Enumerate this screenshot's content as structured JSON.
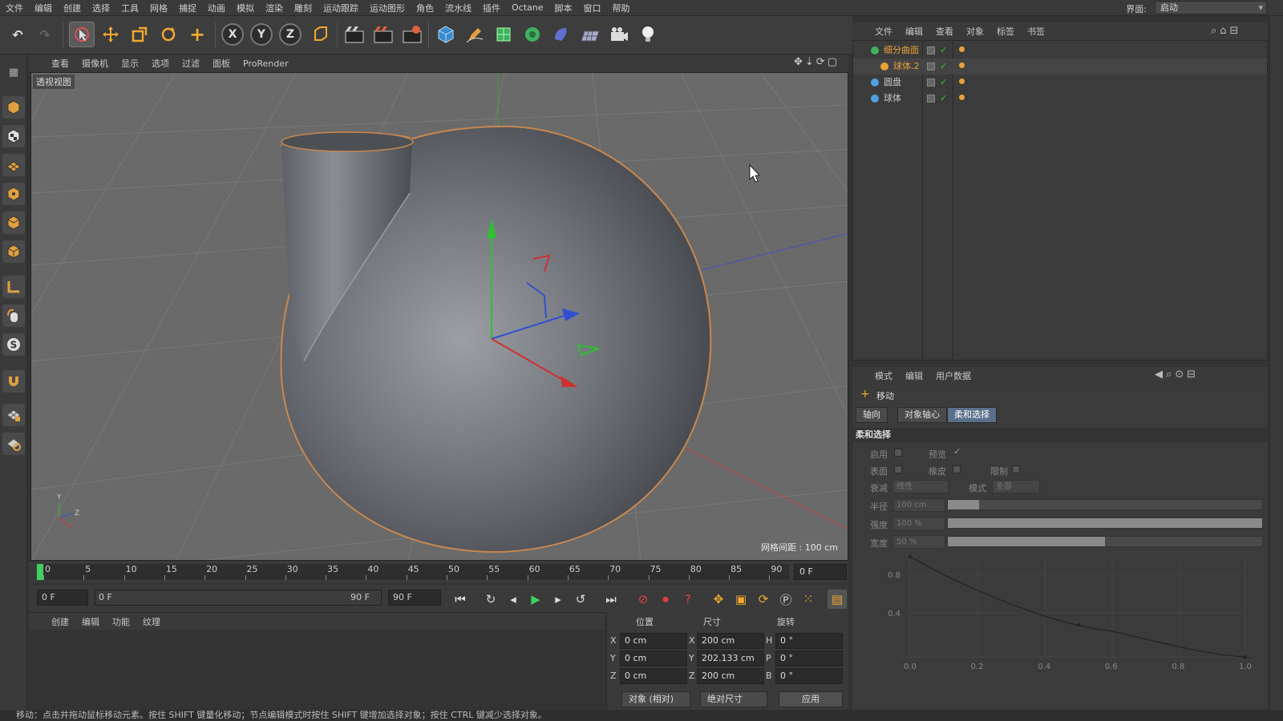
{
  "menubar": {
    "items": [
      "文件",
      "编辑",
      "创建",
      "选择",
      "工具",
      "网格",
      "捕捉",
      "动画",
      "模拟",
      "渲染",
      "雕刻",
      "运动跟踪",
      "运动图形",
      "角色",
      "流水线",
      "插件",
      "Octane",
      "脚本",
      "窗口",
      "帮助"
    ],
    "layout_label": "界面:",
    "layout_value": "启动"
  },
  "viewport": {
    "menu": [
      "查看",
      "摄像机",
      "显示",
      "选项",
      "过滤",
      "面板",
      "ProRender"
    ],
    "label": "透视视图",
    "grid_info": "网格间距 : 100 cm"
  },
  "timeline": {
    "ticks": [
      "0",
      "5",
      "10",
      "15",
      "20",
      "25",
      "30",
      "35",
      "40",
      "45",
      "50",
      "55",
      "60",
      "65",
      "70",
      "75",
      "80",
      "85",
      "90"
    ],
    "current_frame": "0 F",
    "start_field": "0 F",
    "range_start": "0 F",
    "range_end": "90 F",
    "end_field": "90 F"
  },
  "material_manager": {
    "menu": [
      "创建",
      "编辑",
      "功能",
      "纹理"
    ]
  },
  "coordinates": {
    "headers": {
      "position": "位置",
      "size": "尺寸",
      "rotation": "旋转"
    },
    "rows": [
      {
        "axis": "X",
        "pos": "0 cm",
        "size_axis": "X",
        "size": "200 cm",
        "rot_axis": "H",
        "rot": "0 °"
      },
      {
        "axis": "Y",
        "pos": "0 cm",
        "size_axis": "Y",
        "size": "202.133 cm",
        "rot_axis": "P",
        "rot": "0 °"
      },
      {
        "axis": "Z",
        "pos": "0 cm",
        "size_axis": "Z",
        "size": "200 cm",
        "rot_axis": "B",
        "rot": "0 °"
      }
    ],
    "mode_dropdown": "对象 (相对)",
    "size_dropdown": "绝对尺寸",
    "apply": "应用"
  },
  "object_manager": {
    "menu": [
      "文件",
      "编辑",
      "查看",
      "对象",
      "标签",
      "书签"
    ],
    "objects": [
      {
        "name": "细分曲面",
        "color": "#e8a23a"
      },
      {
        "name": "球体.2",
        "color": "#e8a23a"
      },
      {
        "name": "圆盘",
        "color": "#c8c8c8"
      },
      {
        "name": "球体",
        "color": "#c8c8c8"
      }
    ]
  },
  "attributes": {
    "menu": [
      "模式",
      "编辑",
      "用户数据"
    ],
    "tool_name": "移动",
    "tabs": [
      "轴向",
      "对象轴心",
      "柔和选择"
    ],
    "active_tab": "柔和选择",
    "section": "柔和选择",
    "labels": {
      "enable": "启用",
      "preview": "预览",
      "surface": "表面",
      "rubber": "橡皮",
      "restrict": "限制",
      "falloff": "衰减",
      "mode": "模式",
      "radius": "半径",
      "strength": "强度",
      "width": "宽度"
    },
    "values": {
      "falloff": "线性",
      "mode": "全部",
      "radius": "100 cm",
      "strength": "100 %",
      "width": "50 %"
    },
    "slider_levels": {
      "radius": 0.1,
      "strength": 1.0,
      "width": 0.5
    },
    "curve": {
      "x_ticks": [
        "0.0",
        "0.2",
        "0.4",
        "0.6",
        "0.8",
        "1.0"
      ],
      "y_ticks": [
        "0.4",
        "0.8"
      ]
    }
  },
  "status": "移动：点击并拖动鼠标移动元素。按住 SHIFT 键量化移动；节点编辑模式时按住 SHIFT 键增加选择对象；按住 CTRL 键减少选择对象。",
  "colors": {
    "accent": "#e8a23a",
    "active_tab": "#5a6f8c",
    "x_axis": "#d03030",
    "y_axis": "#30c030",
    "z_axis": "#3050d0"
  }
}
